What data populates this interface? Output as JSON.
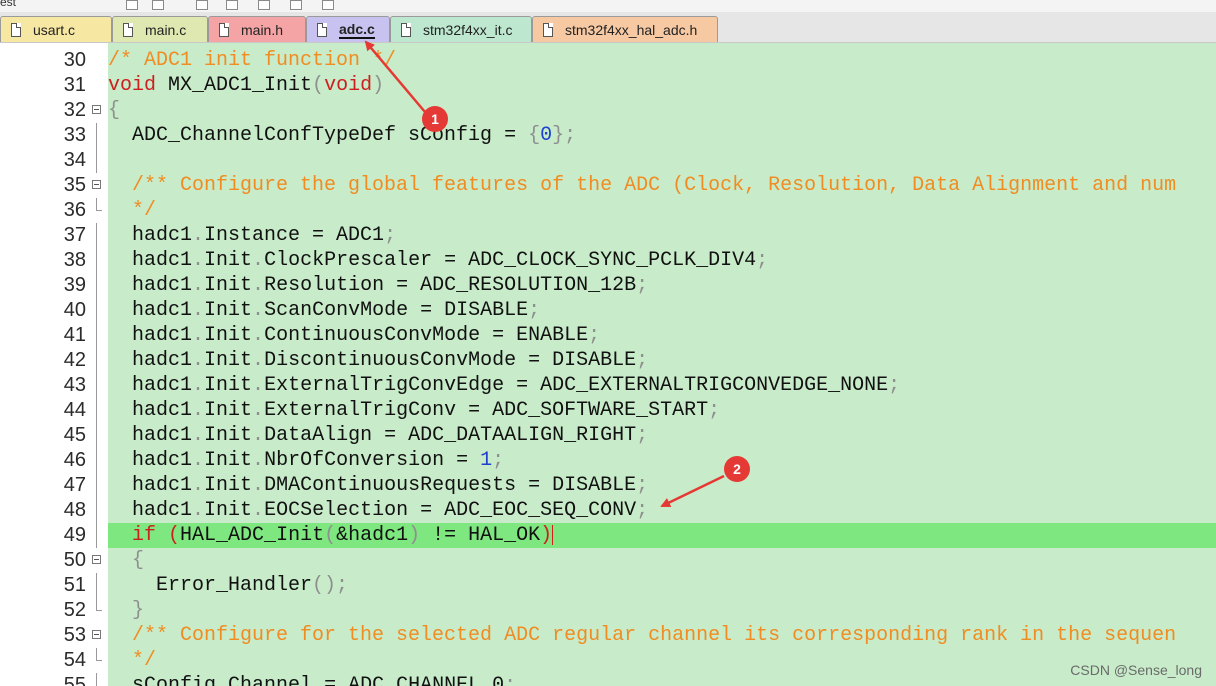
{
  "toolbar": {
    "label": "est"
  },
  "tabs": [
    {
      "label": "usart.c",
      "color": "#f6e7a3",
      "active": false
    },
    {
      "label": "main.c",
      "color": "#dfe8b0",
      "active": false
    },
    {
      "label": "main.h",
      "color": "#f4a4a4",
      "active": false
    },
    {
      "label": "adc.c",
      "color": "#c7c2ef",
      "active": true
    },
    {
      "label": "stm32f4xx_it.c",
      "color": "#bde8cf",
      "active": false
    },
    {
      "label": "stm32f4xx_hal_adc.h",
      "color": "#f7c9a3",
      "active": false
    }
  ],
  "editor": {
    "background": "#c8ecca",
    "highlight_color": "#7fe77f",
    "lines": [
      {
        "num": "30",
        "fold": "",
        "segs": [
          [
            "c-comment",
            "/* ADC1 init function */"
          ]
        ]
      },
      {
        "num": "31",
        "fold": "",
        "segs": [
          [
            "c-kw",
            "void"
          ],
          [
            "",
            " MX_ADC1_Init"
          ],
          [
            "c-punc",
            "("
          ],
          [
            "c-kw",
            "void"
          ],
          [
            "c-punc",
            ")"
          ]
        ]
      },
      {
        "num": "32",
        "fold": "start",
        "segs": [
          [
            "c-punc",
            "{"
          ]
        ]
      },
      {
        "num": "33",
        "fold": "line",
        "segs": [
          [
            "",
            "  ADC_ChannelConfTypeDef sConfig = "
          ],
          [
            "c-punc",
            "{"
          ],
          [
            "c-num",
            "0"
          ],
          [
            "c-punc",
            "};"
          ]
        ]
      },
      {
        "num": "34",
        "fold": "line",
        "segs": []
      },
      {
        "num": "35",
        "fold": "start",
        "segs": [
          [
            "c-comment",
            "  /** Configure the global features of the ADC (Clock, Resolution, Data Alignment and num"
          ]
        ]
      },
      {
        "num": "36",
        "fold": "end",
        "segs": [
          [
            "c-comment",
            "  */"
          ]
        ]
      },
      {
        "num": "37",
        "fold": "line",
        "segs": [
          [
            "",
            "  hadc1"
          ],
          [
            "c-punc",
            "."
          ],
          [
            "",
            "Instance = ADC1"
          ],
          [
            "c-punc",
            ";"
          ]
        ]
      },
      {
        "num": "38",
        "fold": "line",
        "segs": [
          [
            "",
            "  hadc1"
          ],
          [
            "c-punc",
            "."
          ],
          [
            "",
            "Init"
          ],
          [
            "c-punc",
            "."
          ],
          [
            "",
            "ClockPrescaler = ADC_CLOCK_SYNC_PCLK_DIV4"
          ],
          [
            "c-punc",
            ";"
          ]
        ]
      },
      {
        "num": "39",
        "fold": "line",
        "segs": [
          [
            "",
            "  hadc1"
          ],
          [
            "c-punc",
            "."
          ],
          [
            "",
            "Init"
          ],
          [
            "c-punc",
            "."
          ],
          [
            "",
            "Resolution = ADC_RESOLUTION_12B"
          ],
          [
            "c-punc",
            ";"
          ]
        ]
      },
      {
        "num": "40",
        "fold": "line",
        "segs": [
          [
            "",
            "  hadc1"
          ],
          [
            "c-punc",
            "."
          ],
          [
            "",
            "Init"
          ],
          [
            "c-punc",
            "."
          ],
          [
            "",
            "ScanConvMode = DISABLE"
          ],
          [
            "c-punc",
            ";"
          ]
        ]
      },
      {
        "num": "41",
        "fold": "line",
        "segs": [
          [
            "",
            "  hadc1"
          ],
          [
            "c-punc",
            "."
          ],
          [
            "",
            "Init"
          ],
          [
            "c-punc",
            "."
          ],
          [
            "",
            "ContinuousConvMode = ENABLE"
          ],
          [
            "c-punc",
            ";"
          ]
        ]
      },
      {
        "num": "42",
        "fold": "line",
        "segs": [
          [
            "",
            "  hadc1"
          ],
          [
            "c-punc",
            "."
          ],
          [
            "",
            "Init"
          ],
          [
            "c-punc",
            "."
          ],
          [
            "",
            "DiscontinuousConvMode = DISABLE"
          ],
          [
            "c-punc",
            ";"
          ]
        ]
      },
      {
        "num": "43",
        "fold": "line",
        "segs": [
          [
            "",
            "  hadc1"
          ],
          [
            "c-punc",
            "."
          ],
          [
            "",
            "Init"
          ],
          [
            "c-punc",
            "."
          ],
          [
            "",
            "ExternalTrigConvEdge = ADC_EXTERNALTRIGCONVEDGE_NONE"
          ],
          [
            "c-punc",
            ";"
          ]
        ]
      },
      {
        "num": "44",
        "fold": "line",
        "segs": [
          [
            "",
            "  hadc1"
          ],
          [
            "c-punc",
            "."
          ],
          [
            "",
            "Init"
          ],
          [
            "c-punc",
            "."
          ],
          [
            "",
            "ExternalTrigConv = ADC_SOFTWARE_START"
          ],
          [
            "c-punc",
            ";"
          ]
        ]
      },
      {
        "num": "45",
        "fold": "line",
        "segs": [
          [
            "",
            "  hadc1"
          ],
          [
            "c-punc",
            "."
          ],
          [
            "",
            "Init"
          ],
          [
            "c-punc",
            "."
          ],
          [
            "",
            "DataAlign = ADC_DATAALIGN_RIGHT"
          ],
          [
            "c-punc",
            ";"
          ]
        ]
      },
      {
        "num": "46",
        "fold": "line",
        "segs": [
          [
            "",
            "  hadc1"
          ],
          [
            "c-punc",
            "."
          ],
          [
            "",
            "Init"
          ],
          [
            "c-punc",
            "."
          ],
          [
            "",
            "NbrOfConversion = "
          ],
          [
            "c-num",
            "1"
          ],
          [
            "c-punc",
            ";"
          ]
        ]
      },
      {
        "num": "47",
        "fold": "line",
        "segs": [
          [
            "",
            "  hadc1"
          ],
          [
            "c-punc",
            "."
          ],
          [
            "",
            "Init"
          ],
          [
            "c-punc",
            "."
          ],
          [
            "",
            "DMAContinuousRequests = DISABLE"
          ],
          [
            "c-punc",
            ";"
          ]
        ]
      },
      {
        "num": "48",
        "fold": "line",
        "segs": [
          [
            "",
            "  hadc1"
          ],
          [
            "c-punc",
            "."
          ],
          [
            "",
            "Init"
          ],
          [
            "c-punc",
            "."
          ],
          [
            "",
            "EOCSelection = ADC_EOC_SEQ_CONV"
          ],
          [
            "c-punc",
            ";"
          ]
        ]
      },
      {
        "num": "49",
        "fold": "line",
        "hl": true,
        "segs": [
          [
            "c-kw",
            "  if"
          ],
          [
            "",
            " "
          ],
          [
            "c-red",
            "("
          ],
          [
            "",
            "HAL_ADC_Init"
          ],
          [
            "c-punc",
            "("
          ],
          [
            "",
            "&hadc1"
          ],
          [
            "c-punc",
            ")"
          ],
          [
            "",
            " != HAL_OK"
          ],
          [
            "c-red",
            ")"
          ]
        ]
      },
      {
        "num": "50",
        "fold": "start",
        "segs": [
          [
            "c-punc",
            "  {"
          ]
        ]
      },
      {
        "num": "51",
        "fold": "line",
        "segs": [
          [
            "",
            "    Error_Handler"
          ],
          [
            "c-punc",
            "();"
          ]
        ]
      },
      {
        "num": "52",
        "fold": "end",
        "segs": [
          [
            "c-punc",
            "  }"
          ]
        ]
      },
      {
        "num": "53",
        "fold": "start",
        "segs": [
          [
            "c-comment",
            "  /** Configure for the selected ADC regular channel its corresponding rank in the sequen"
          ]
        ]
      },
      {
        "num": "54",
        "fold": "end",
        "segs": [
          [
            "c-comment",
            "  */"
          ]
        ]
      },
      {
        "num": "55",
        "fold": "line",
        "segs": [
          [
            "",
            "  sConfig"
          ],
          [
            "c-punc",
            "."
          ],
          [
            "",
            "Channel = ADC_CHANNEL_0"
          ],
          [
            "c-punc",
            ";"
          ]
        ]
      }
    ]
  },
  "annotations": [
    {
      "label": "1",
      "color": "#e53935"
    },
    {
      "label": "2",
      "color": "#e53935"
    }
  ],
  "watermark": "CSDN @Sense_long"
}
